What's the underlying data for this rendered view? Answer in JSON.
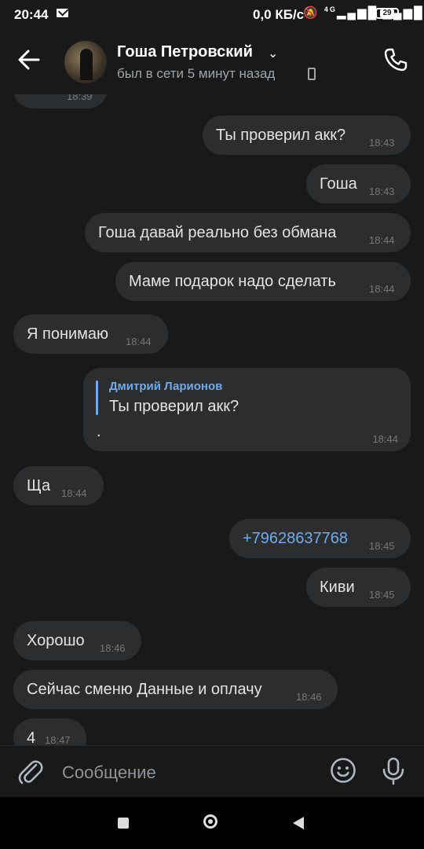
{
  "status": {
    "time": "20:44",
    "speed": "0,0 КБ/с",
    "network": "4G",
    "battery": "29"
  },
  "header": {
    "name": "Гоша Петровский",
    "seen": "был в сети 5 минут назад"
  },
  "messages": [
    {
      "text": "",
      "time": "18:39"
    },
    {
      "text": "Ты проверил акк?",
      "time": "18:43"
    },
    {
      "text": "Гоша",
      "time": "18:43"
    },
    {
      "text": "Гоша давай реально без обмана",
      "time": "18:44"
    },
    {
      "text": "Маме подарок надо сделать",
      "time": "18:44"
    },
    {
      "text": "Я понимаю",
      "time": "18:44"
    },
    {
      "reply_author": "Дмитрий Ларионов",
      "reply_text": "Ты проверил акк?",
      "text": ".",
      "time": "18:44"
    },
    {
      "text": "Ща",
      "time": "18:44"
    },
    {
      "text": "+79628637768",
      "time": "18:45"
    },
    {
      "text": "Киви",
      "time": "18:45"
    },
    {
      "text": "Хорошо",
      "time": "18:46"
    },
    {
      "text": "Сейчас сменю Данные и оплачу",
      "time": "18:46"
    },
    {
      "text": "4",
      "time": "18:47"
    }
  ],
  "composer": {
    "placeholder": "Сообщение"
  },
  "colors": {
    "background": "#19191a",
    "bubble": "#2c2d2e",
    "accent": "#71aaeb"
  }
}
